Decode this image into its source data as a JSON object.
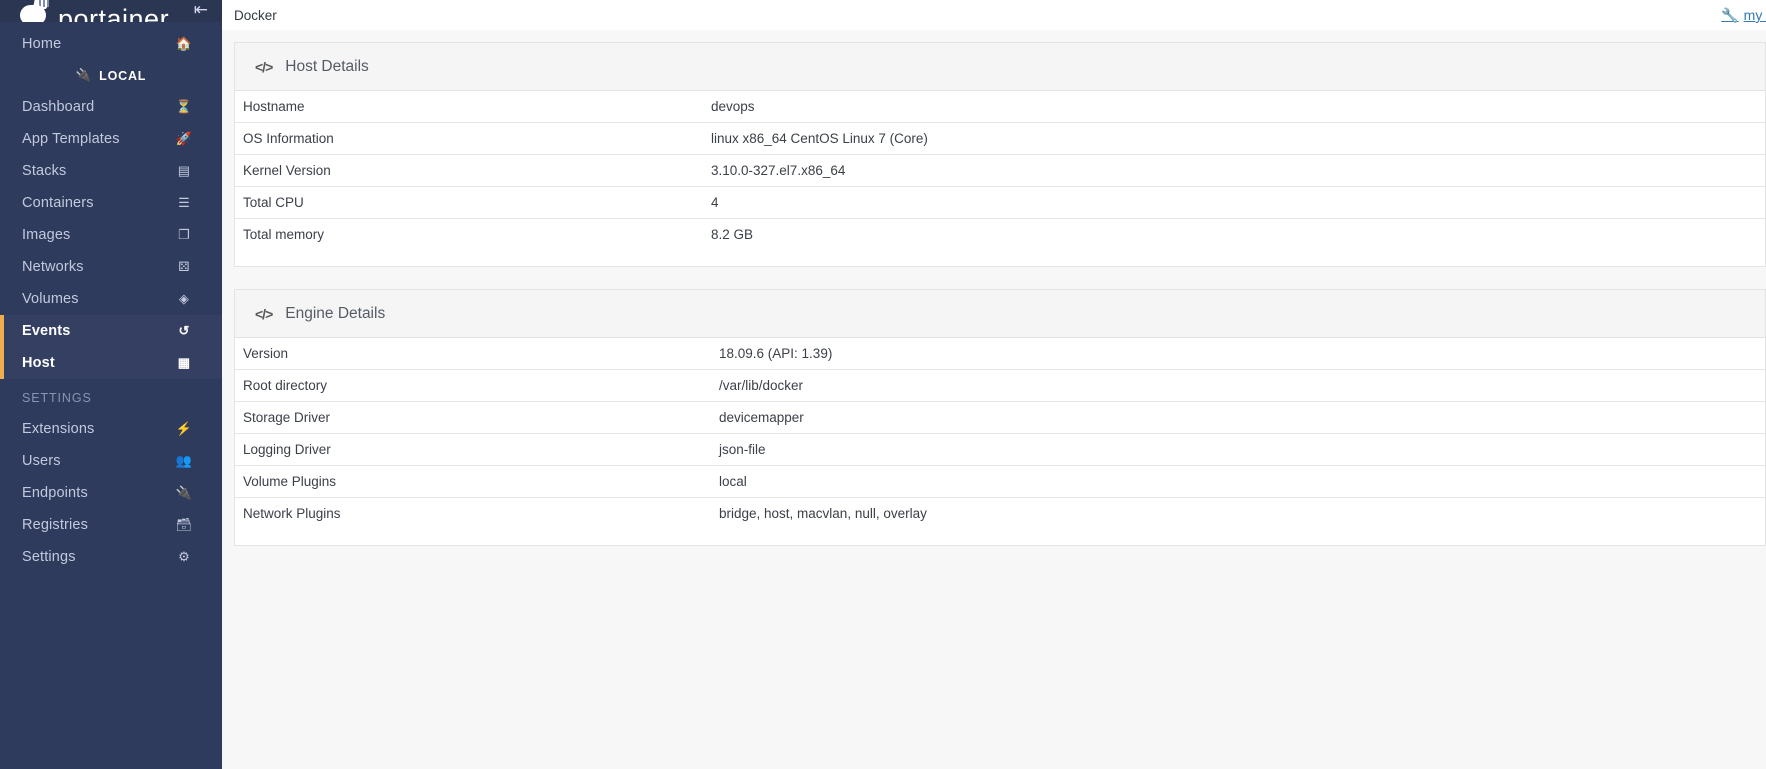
{
  "brand": {
    "name": "portainer",
    "logo_icon": "portainer-whale-logo",
    "collapse_icon": "collapse-arrow-icon"
  },
  "sidebar": {
    "home": {
      "label": "Home",
      "icon": "home-icon"
    },
    "endpoint_group": {
      "label": "LOCAL",
      "icon": "plug-icon"
    },
    "items": [
      {
        "label": "Dashboard",
        "icon": "dashboard-icon",
        "active": false
      },
      {
        "label": "App Templates",
        "icon": "rocket-icon",
        "active": false
      },
      {
        "label": "Stacks",
        "icon": "stacks-icon",
        "active": false
      },
      {
        "label": "Containers",
        "icon": "containers-icon",
        "active": false
      },
      {
        "label": "Images",
        "icon": "images-icon",
        "active": false
      },
      {
        "label": "Networks",
        "icon": "networks-icon",
        "active": false
      },
      {
        "label": "Volumes",
        "icon": "volumes-icon",
        "active": false
      },
      {
        "label": "Events",
        "icon": "history-icon",
        "active": true
      },
      {
        "label": "Host",
        "icon": "grid-icon",
        "active": true
      }
    ],
    "settings_section": {
      "title": "SETTINGS",
      "items": [
        {
          "label": "Extensions",
          "icon": "bolt-icon"
        },
        {
          "label": "Users",
          "icon": "users-icon"
        },
        {
          "label": "Endpoints",
          "icon": "plug-icon"
        },
        {
          "label": "Registries",
          "icon": "database-icon"
        },
        {
          "label": "Settings",
          "icon": "gears-icon"
        }
      ]
    },
    "colors": {
      "background": "#2f3b5c",
      "active_background": "#343f62",
      "active_accent": "#f0ad4e",
      "text": "#c2c9de",
      "active_text": "#ffffff"
    }
  },
  "topbar": {
    "breadcrumb": "Docker",
    "account_label": "my a",
    "account_icon": "wrench-icon",
    "link_color": "#337ab7"
  },
  "panels": [
    {
      "title": "Host Details",
      "icon": "code-icon",
      "rows": [
        {
          "key": "Hostname",
          "value": "devops"
        },
        {
          "key": "OS Information",
          "value": "linux x86_64 CentOS Linux 7 (Core)"
        },
        {
          "key": "Kernel Version",
          "value": "3.10.0-327.el7.x86_64"
        },
        {
          "key": "Total CPU",
          "value": "4"
        },
        {
          "key": "Total memory",
          "value": "8.2 GB"
        }
      ]
    },
    {
      "title": "Engine Details",
      "icon": "code-icon",
      "rows": [
        {
          "key": "Version",
          "value": "18.09.6 (API: 1.39)"
        },
        {
          "key": "Root directory",
          "value": "/var/lib/docker"
        },
        {
          "key": "Storage Driver",
          "value": "devicemapper"
        },
        {
          "key": "Logging Driver",
          "value": "json-file"
        },
        {
          "key": "Volume Plugins",
          "value": "local"
        },
        {
          "key": "Network Plugins",
          "value": "bridge, host, macvlan, null, overlay"
        }
      ]
    }
  ]
}
